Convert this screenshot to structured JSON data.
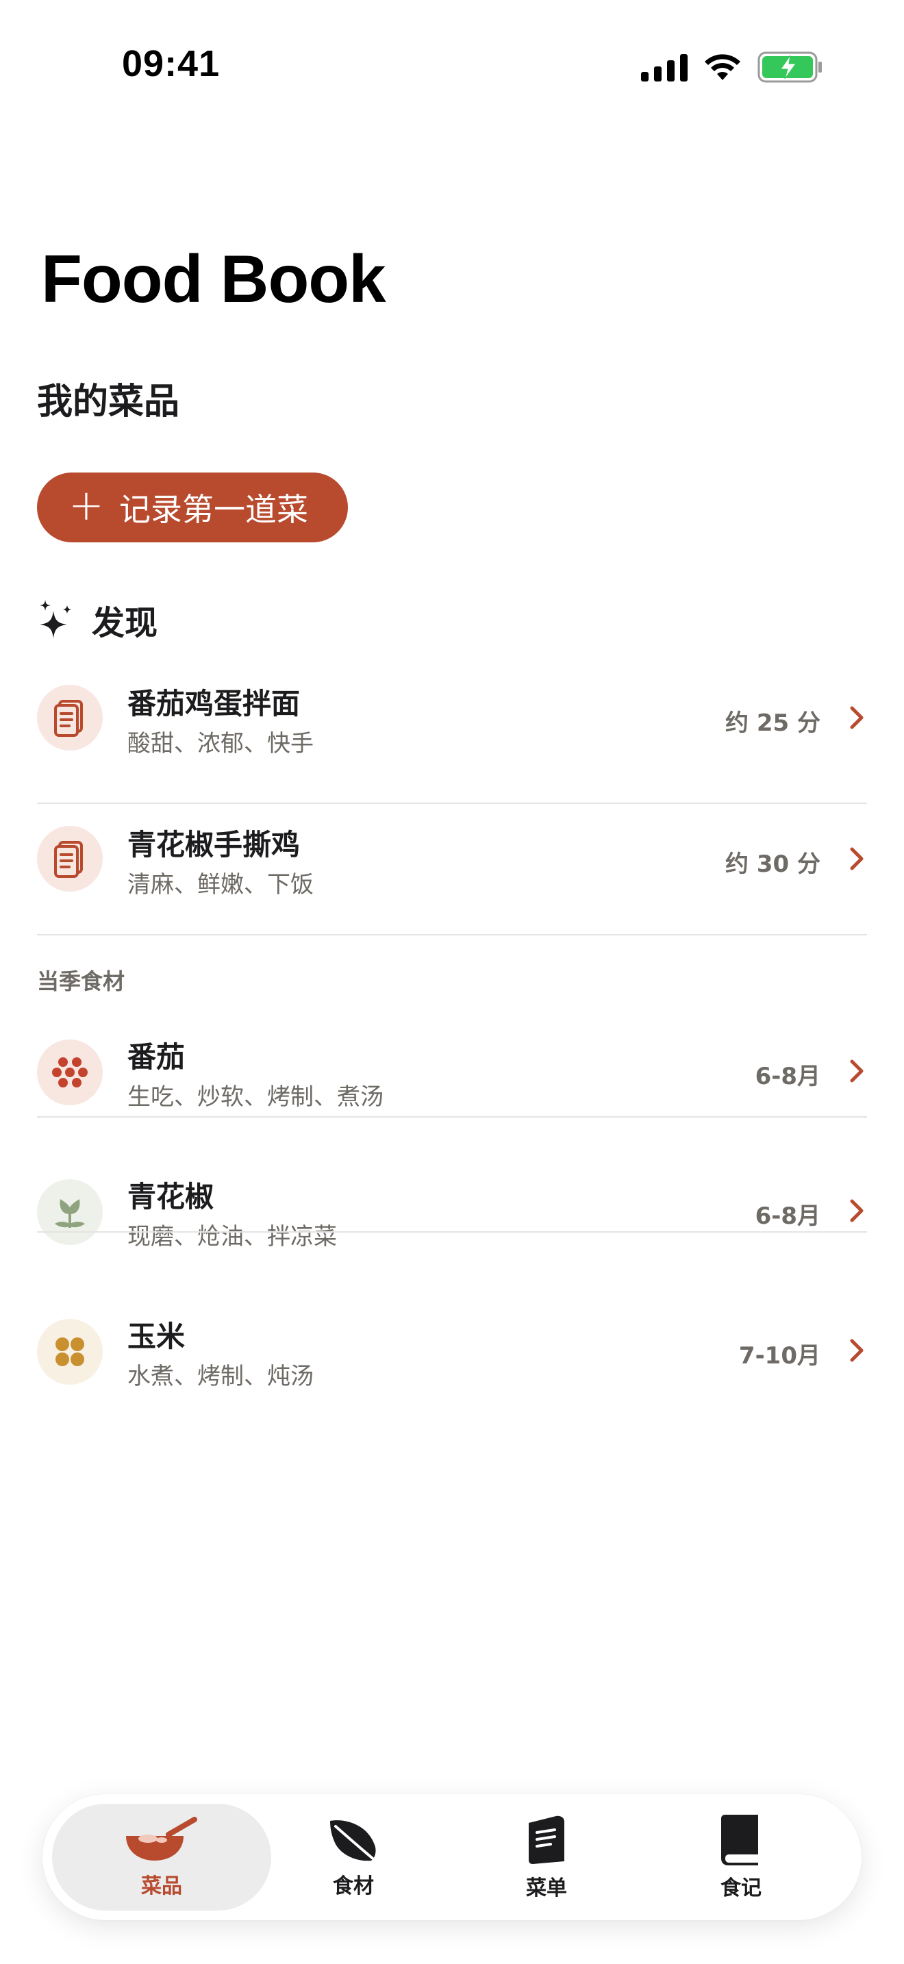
{
  "status_bar": {
    "time": "09:41"
  },
  "header": {
    "app_title": "Food Book",
    "section_title": "我的菜品"
  },
  "actions": {
    "add_first_dish": "记录第一道菜"
  },
  "discover": {
    "title": "发现",
    "items": [
      {
        "title": "番茄鸡蛋拌面",
        "subtitle": "酸甜、浓郁、快手",
        "meta": "约 25 分"
      },
      {
        "title": "青花椒手撕鸡",
        "subtitle": "清麻、鲜嫩、下饭",
        "meta": "约 30 分"
      }
    ]
  },
  "seasonal": {
    "title": "当季食材",
    "items": [
      {
        "title": "番茄",
        "subtitle": "生吃、炒软、烤制、煮汤",
        "meta": "6-8月"
      },
      {
        "title": "青花椒",
        "subtitle": "现磨、炝油、拌凉菜",
        "meta": "6-8月"
      },
      {
        "title": "玉米",
        "subtitle": "水煮、烤制、炖汤",
        "meta": "7-10月"
      }
    ]
  },
  "tab_bar": {
    "tabs": [
      {
        "label": "菜品",
        "icon": "bowl-icon",
        "active": true
      },
      {
        "label": "食材",
        "icon": "leaf-icon",
        "active": false
      },
      {
        "label": "菜单",
        "icon": "menu-book-icon",
        "active": false
      },
      {
        "label": "食记",
        "icon": "journal-book-icon",
        "active": false
      }
    ]
  },
  "colors": {
    "accent": "#b84a2e",
    "text": "#1c1c1e",
    "secondary": "#6e6a65",
    "battery": "#34c759"
  }
}
